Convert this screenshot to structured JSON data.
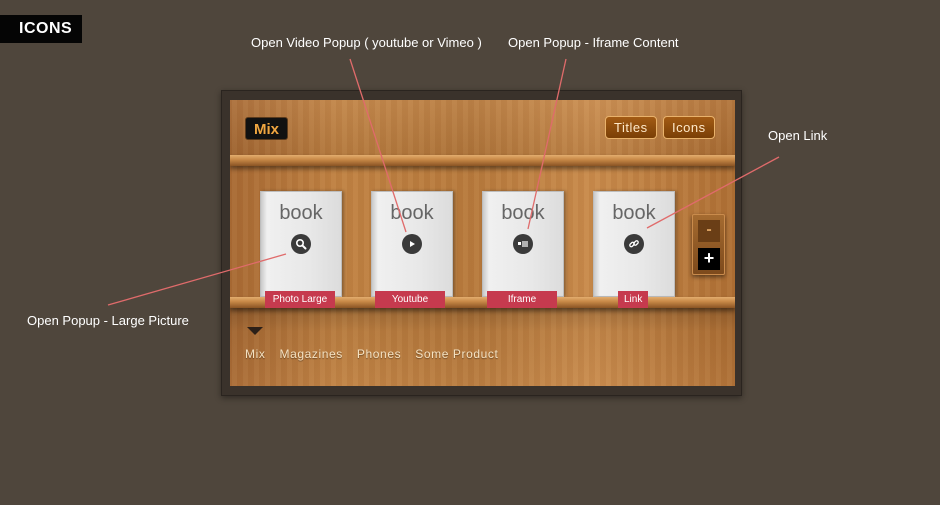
{
  "section_badge": "ICONS",
  "annotations": {
    "video_popup": "Open Video Popup ( youtube or Vimeo )",
    "iframe_popup": "Open Popup - Iframe Content",
    "open_link": "Open Link",
    "large_picture": "Open Popup - Large Picture"
  },
  "shelf": {
    "active_category": "Mix",
    "mode_buttons": [
      "Titles",
      "Icons"
    ],
    "books": [
      {
        "title": "book",
        "label": "Photo Large",
        "icon": "search-icon"
      },
      {
        "title": "book",
        "label": "Youtube",
        "icon": "play-icon"
      },
      {
        "title": "book",
        "label": "Iframe",
        "icon": "iframe-icon"
      },
      {
        "title": "book",
        "label": "Link",
        "icon": "link-icon"
      }
    ],
    "zoom": {
      "minus": "-",
      "plus": "+"
    },
    "categories": [
      "Mix",
      "Magazines",
      "Phones",
      "Some Product"
    ]
  },
  "colors": {
    "page_background": "#4f463c",
    "badge_background": "#050505",
    "label_red": "#c63a4e",
    "annotation_line": "#e06b6b",
    "mix_text": "#f0a640",
    "button_brown": "#7a3f06"
  }
}
